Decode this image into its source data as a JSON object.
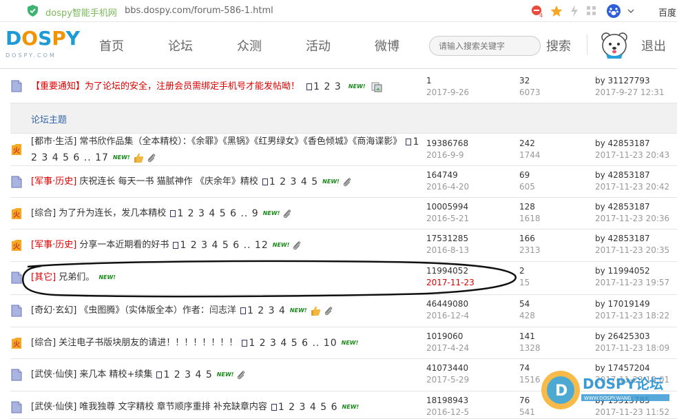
{
  "browser": {
    "site_name": "dospy智能手机网",
    "url": "bbs.dospy.com/forum-586-1.html",
    "badge_count": "4",
    "baidu_label": "百度"
  },
  "header": {
    "logo_text": "DOSPY",
    "logo_sub": "DOSPY.COM",
    "nav": [
      "首页",
      "论坛",
      "众测",
      "活动",
      "微博"
    ],
    "search_placeholder": "请输入搜索关键字",
    "search_button": "搜索",
    "logout": "退出"
  },
  "notice": {
    "title": "【重要通知】为了论坛的安全，注册会员需绑定手机号才能发帖呦！",
    "pages": "1 2 3",
    "new": "NEW!",
    "c1_top": "1",
    "c1_bot": "2017-9-26",
    "c2_top": "32",
    "c2_bot": "6073",
    "c3_top": "by 31127793",
    "c3_bot": "2017-9-27 12:31"
  },
  "section_label": "论坛主题",
  "threads": [
    {
      "icon": "hot",
      "tag": "[都市·生活]",
      "tag_red": false,
      "title": "常书欣作品集（全本精校）：《余罪》《黑锅》《红男绿女》《香色倾城》《商海谍影》",
      "pages": "1 2 3 4 5 6 .. 17",
      "new": "NEW!",
      "thumb": true,
      "clip": true,
      "c1_top": "19386768",
      "c1_bot": "2016-9-9",
      "c1_red": false,
      "c2_top": "242",
      "c2_bot": "1744",
      "c3_top": "by 42853187",
      "c3_bot": "2017-11-23 20:43"
    },
    {
      "icon": "doc",
      "tag": "[军事·历史]",
      "tag_red": true,
      "title": "庆祝连长 每天一书 猫腻神作 《庆余年》精校",
      "pages": "1 2 3 4 5",
      "new": "NEW!",
      "thumb": false,
      "clip": true,
      "c1_top": "164749",
      "c1_bot": "2016-4-20",
      "c1_red": false,
      "c2_top": "69",
      "c2_bot": "605",
      "c3_top": "by 42853187",
      "c3_bot": "2017-11-23 20:42"
    },
    {
      "icon": "hot",
      "tag": "[综合]",
      "tag_red": false,
      "title": "为了升为连长，发几本精校",
      "pages": "1 2 3 4 5 6 .. 9",
      "new": "NEW!",
      "thumb": false,
      "clip": true,
      "c1_top": "10005994",
      "c1_bot": "2016-5-21",
      "c1_red": false,
      "c2_top": "128",
      "c2_bot": "1618",
      "c3_top": "by 42853187",
      "c3_bot": "2017-11-23 20:36"
    },
    {
      "icon": "hot",
      "tag": "[军事·历史]",
      "tag_red": true,
      "title": "分享一本近期看的好书",
      "pages": "1 2 3 4 5 6 .. 12",
      "new": "NEW!",
      "thumb": false,
      "clip": true,
      "c1_top": "17531285",
      "c1_bot": "2016-8-13",
      "c1_red": false,
      "c2_top": "166",
      "c2_bot": "2313",
      "c3_top": "by 42853187",
      "c3_bot": "2017-11-23 20:35"
    },
    {
      "icon": "doc",
      "tag": "[其它]",
      "tag_red": true,
      "title": "兄弟们。",
      "pages": "",
      "new": "NEW!",
      "thumb": false,
      "clip": false,
      "c1_top": "11994052",
      "c1_bot": "2017-11-23",
      "c1_red": true,
      "c2_top": "2",
      "c2_bot": "15",
      "c3_top": "by 11994052",
      "c3_bot": "2017-11-23 19:57"
    },
    {
      "icon": "doc",
      "tag": "[奇幻·玄幻]",
      "tag_red": false,
      "title": "《虫图腾》（实体版全本）作者：闫志洋",
      "pages": "1 2 3 4",
      "new": "NEW!",
      "thumb": true,
      "clip": true,
      "c1_top": "46449080",
      "c1_bot": "2016-12-4",
      "c1_red": false,
      "c2_top": "54",
      "c2_bot": "428",
      "c3_top": "by 17019149",
      "c3_bot": "2017-11-23 18:22"
    },
    {
      "icon": "hot",
      "tag": "[综合]",
      "tag_red": false,
      "title": "关注电子书版块朋友的请进！！！！！！！！",
      "pages": "1 2 3 4 5 6 .. 10",
      "new": "NEW!",
      "thumb": false,
      "clip": false,
      "c1_top": "1019060",
      "c1_bot": "2017-4-24",
      "c1_red": false,
      "c2_top": "141",
      "c2_bot": "1328",
      "c3_top": "by 26425303",
      "c3_bot": "2017-11-23 18:09"
    },
    {
      "icon": "doc",
      "tag": "[武侠·仙侠]",
      "tag_red": false,
      "title": "来几本 精校+续集",
      "pages": "1 2 3 4 5",
      "new": "NEW!",
      "thumb": false,
      "clip": true,
      "c1_top": "41073440",
      "c1_bot": "2017-5-29",
      "c1_red": false,
      "c2_top": "74",
      "c2_bot": "1516",
      "c3_top": "by 17457204",
      "c3_bot": "2017-11-23 18:01"
    },
    {
      "icon": "doc",
      "tag": "[武侠·仙侠]",
      "tag_red": false,
      "title": "唯我独尊 文字精校 章节顺序重排 补充缺章内容",
      "pages": "1 2 3 4 5 6",
      "new": "NEW!",
      "thumb": false,
      "clip": false,
      "c1_top": "18198943",
      "c1_bot": "2016-12-5",
      "c1_red": false,
      "c2_top": "76",
      "c2_bot": "541",
      "c3_top": "by 19315785",
      "c3_bot": "2017-11-23 11:52"
    }
  ],
  "watermark": {
    "text": "DOSPY论坛",
    "sub": "WWW.DOSPY.WANG"
  },
  "colors": {
    "accent_blue": "#3366aa",
    "red": "#dd0000",
    "logo_blue": "#1e9ad6",
    "logo_orange": "#f29300",
    "green": "#7ab85a"
  }
}
